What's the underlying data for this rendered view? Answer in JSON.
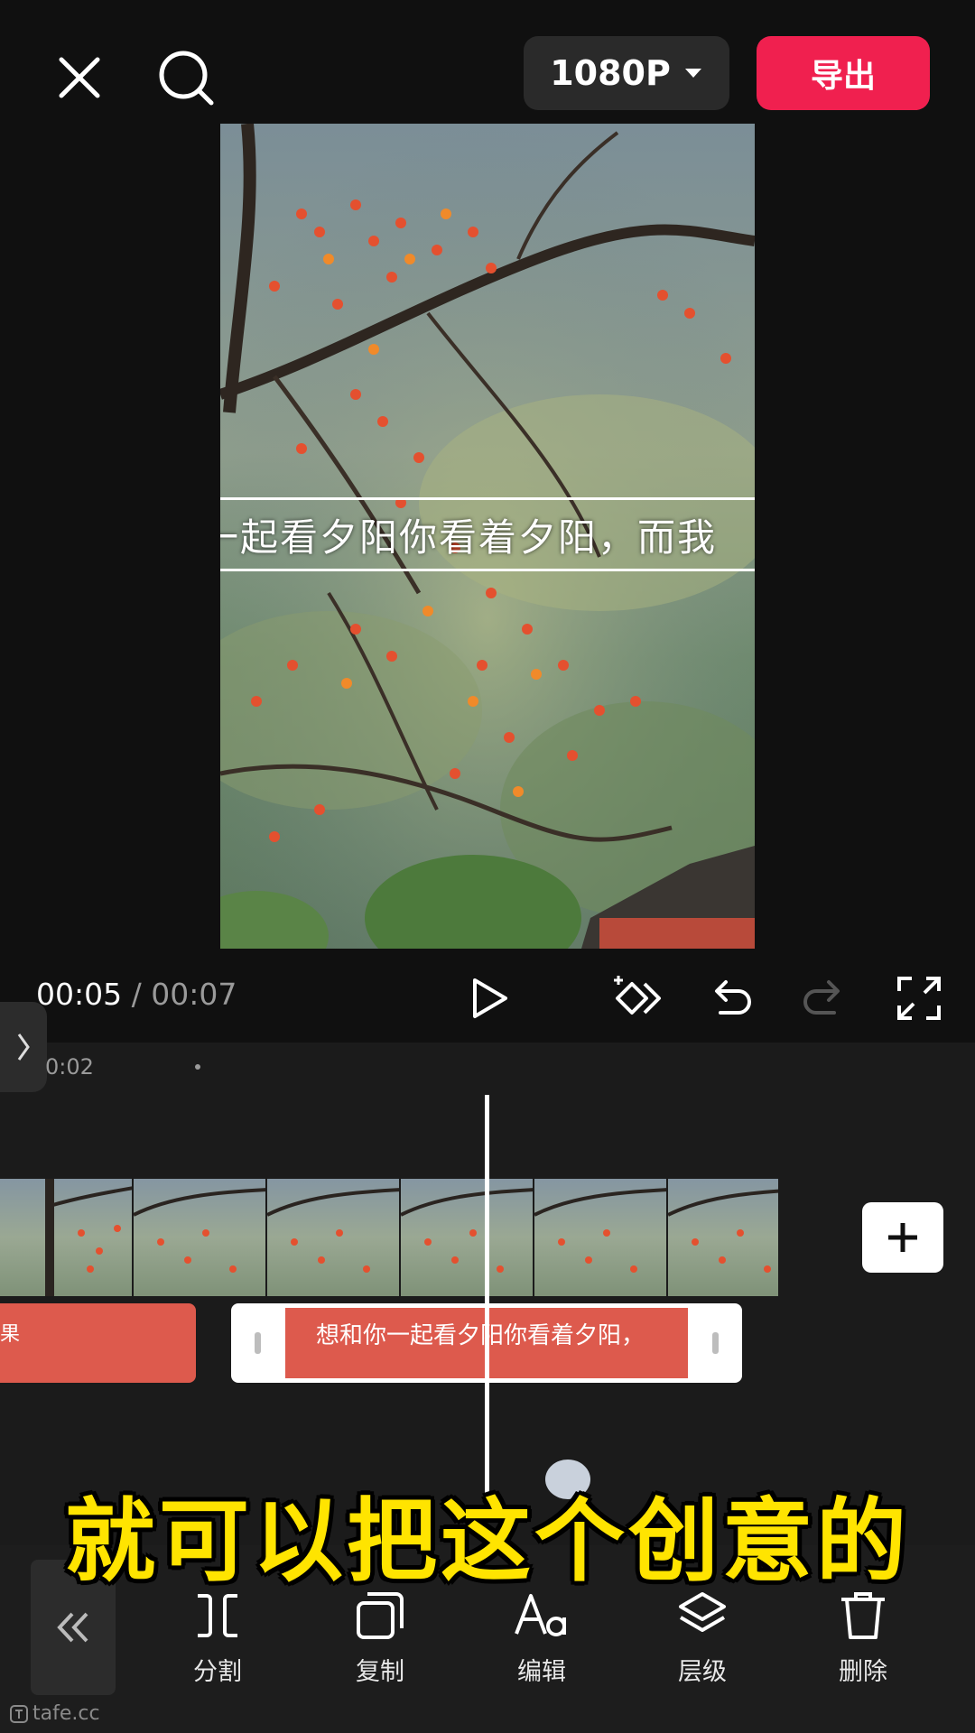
{
  "header": {
    "resolution_label": "1080P",
    "export_label": "导出"
  },
  "preview": {
    "caption": "一起看夕阳你看着夕阳，而我"
  },
  "playback": {
    "current_time": "00:05",
    "separator": "/",
    "total_time": "00:07"
  },
  "timeline": {
    "ruler_time": "0:02",
    "left_clip_text": "果",
    "selected_clip_text": "想和你一起看夕阳你看着夕阳，"
  },
  "subtitle_overlay": "就可以把这个创意的",
  "toolbar": {
    "items": [
      {
        "label": "分割",
        "icon": "split-icon"
      },
      {
        "label": "复制",
        "icon": "copy-icon"
      },
      {
        "label": "编辑",
        "icon": "text-edit-icon"
      },
      {
        "label": "层级",
        "icon": "layers-icon"
      },
      {
        "label": "删除",
        "icon": "trash-icon"
      }
    ]
  },
  "watermark": "tafe.cc",
  "colors": {
    "export_button": "#f0204f",
    "text_clip": "#dd5a4d",
    "subtitle": "#ffe400"
  }
}
